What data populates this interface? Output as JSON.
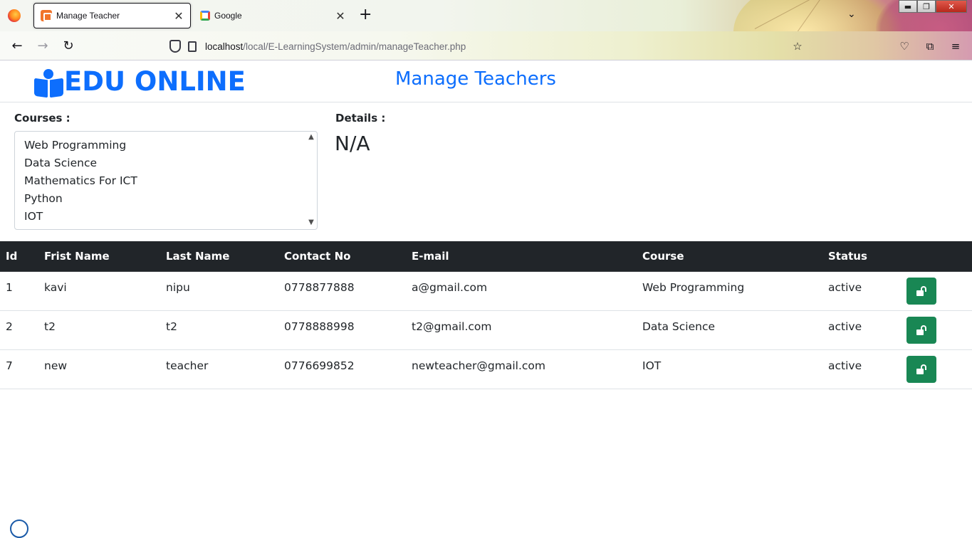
{
  "browser": {
    "tabs": [
      {
        "title": "Manage Teacher",
        "active": true,
        "icon": "xampp-icon"
      },
      {
        "title": "Google",
        "active": false,
        "icon": "google-icon"
      }
    ],
    "url_host": "localhost",
    "url_path": "/local/E-LearningSystem/admin/manageTeacher.php"
  },
  "header": {
    "brand": "EDU ONLINE",
    "page_title": "Manage Teachers"
  },
  "courses": {
    "label": "Courses :",
    "options": [
      "Web Programming",
      "Data Science",
      "Mathematics For ICT",
      "Python",
      "IOT"
    ]
  },
  "details": {
    "label": "Details :",
    "value": "N/A"
  },
  "table": {
    "columns": [
      "Id",
      "Frist Name",
      "Last Name",
      "Contact No",
      "E-mail",
      "Course",
      "Status",
      ""
    ],
    "rows": [
      {
        "id": "1",
        "first": "kavi",
        "last": "nipu",
        "contact": "0778877888",
        "email": "a@gmail.com",
        "course": "Web Programming",
        "status": "active"
      },
      {
        "id": "2",
        "first": "t2",
        "last": "t2",
        "contact": "0778888998",
        "email": "t2@gmail.com",
        "course": "Data Science",
        "status": "active"
      },
      {
        "id": "7",
        "first": "new",
        "last": "teacher",
        "contact": "0776699852",
        "email": "newteacher@gmail.com",
        "course": "IOT",
        "status": "active"
      }
    ]
  },
  "colors": {
    "brand_blue": "#0d6efd",
    "table_header": "#212529",
    "action_green": "#198754"
  }
}
